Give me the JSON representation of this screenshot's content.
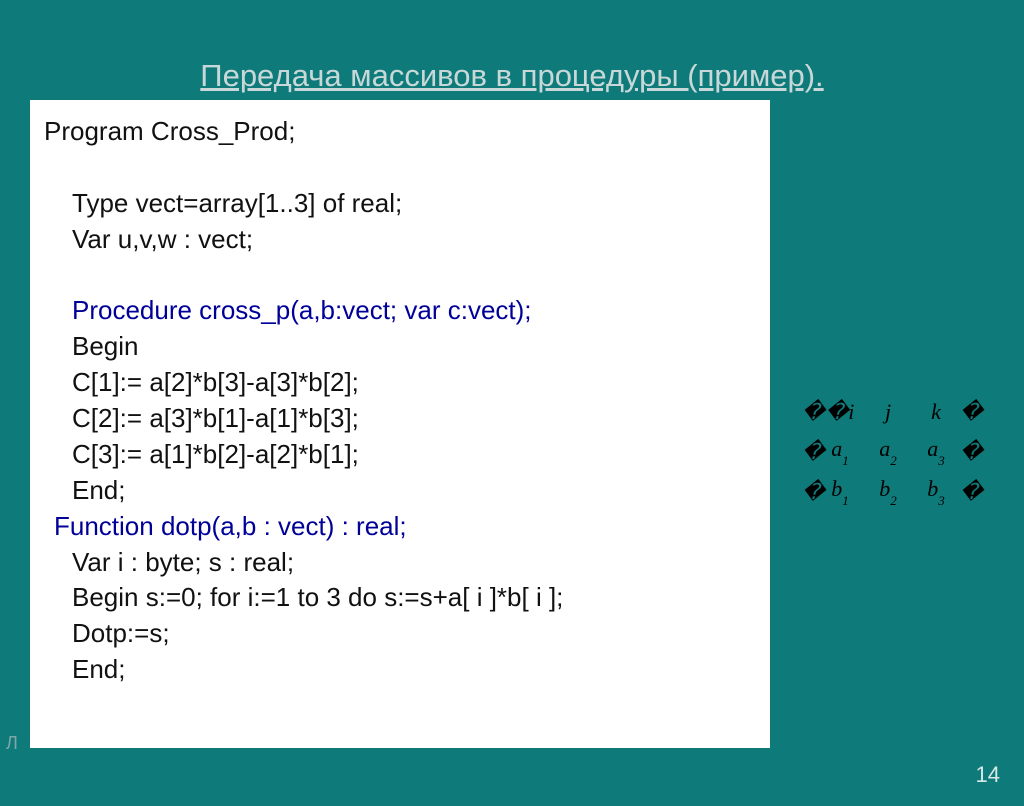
{
  "title": "Передача массивов в процедуры (пример).",
  "code": {
    "l1": "Program Cross_Prod;",
    "l2": "Type vect=array[1..3] of real;",
    "l3": "Var u,v,w : vect;",
    "l4": "Procedure cross_p(a,b:vect; var c:vect);",
    "l5": "Begin",
    "l6": "C[1]:= a[2]*b[3]-a[3]*b[2];",
    "l7": "C[2]:= a[3]*b[1]-a[1]*b[3];",
    "l8": "C[3]:= a[1]*b[2]-a[2]*b[1];",
    "l9": "End;",
    "l10": "Function dotp(a,b : vect) : real;",
    "l11": "Var i : byte; s : real;",
    "l12": "Begin   s:=0;   for i:=1 to 3 do s:=s+a[ i ]*b[ i ];",
    "l13": "Dotp:=s;",
    "l14": "End;"
  },
  "matrix": {
    "row1": {
      "c1": "�i",
      "c2": "j",
      "c3": "k",
      "c4": "�"
    },
    "row2": {
      "c1": "�",
      "base2": "a",
      "sub2": "1",
      "base3": "a",
      "sub3": "2",
      "base4": "a",
      "sub4": "3",
      "c5": "�"
    },
    "row3": {
      "c1": "�",
      "base2": "b",
      "sub2": "1",
      "base3": "b",
      "sub3": "2",
      "base4": "b",
      "sub4": "3",
      "c5": "�"
    }
  },
  "slide_number": "14",
  "footer_mark": "Л"
}
